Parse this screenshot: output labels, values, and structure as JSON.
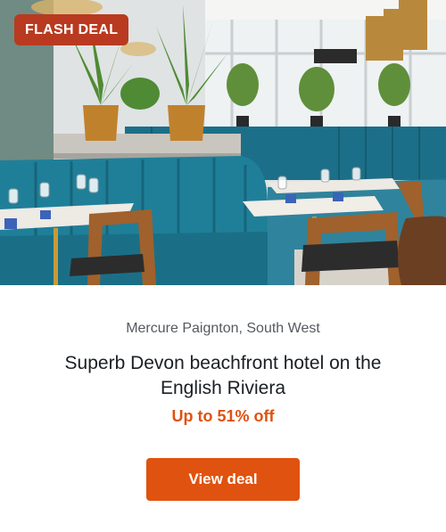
{
  "deal": {
    "badge": "FLASH DEAL",
    "location": "Mercure Paignton, South West",
    "headline": "Superb Devon beachfront hotel on the English Riviera",
    "discount": "Up to 51% off",
    "cta_label": "View deal"
  },
  "hero_image": {
    "subject": "restaurant interior with teal velvet banquettes, marble tables, potted palms and gold pendant lamps"
  },
  "colors": {
    "badge_bg": "#b93a20",
    "accent": "#e0520f",
    "banquette_teal": "#1f7f99"
  }
}
